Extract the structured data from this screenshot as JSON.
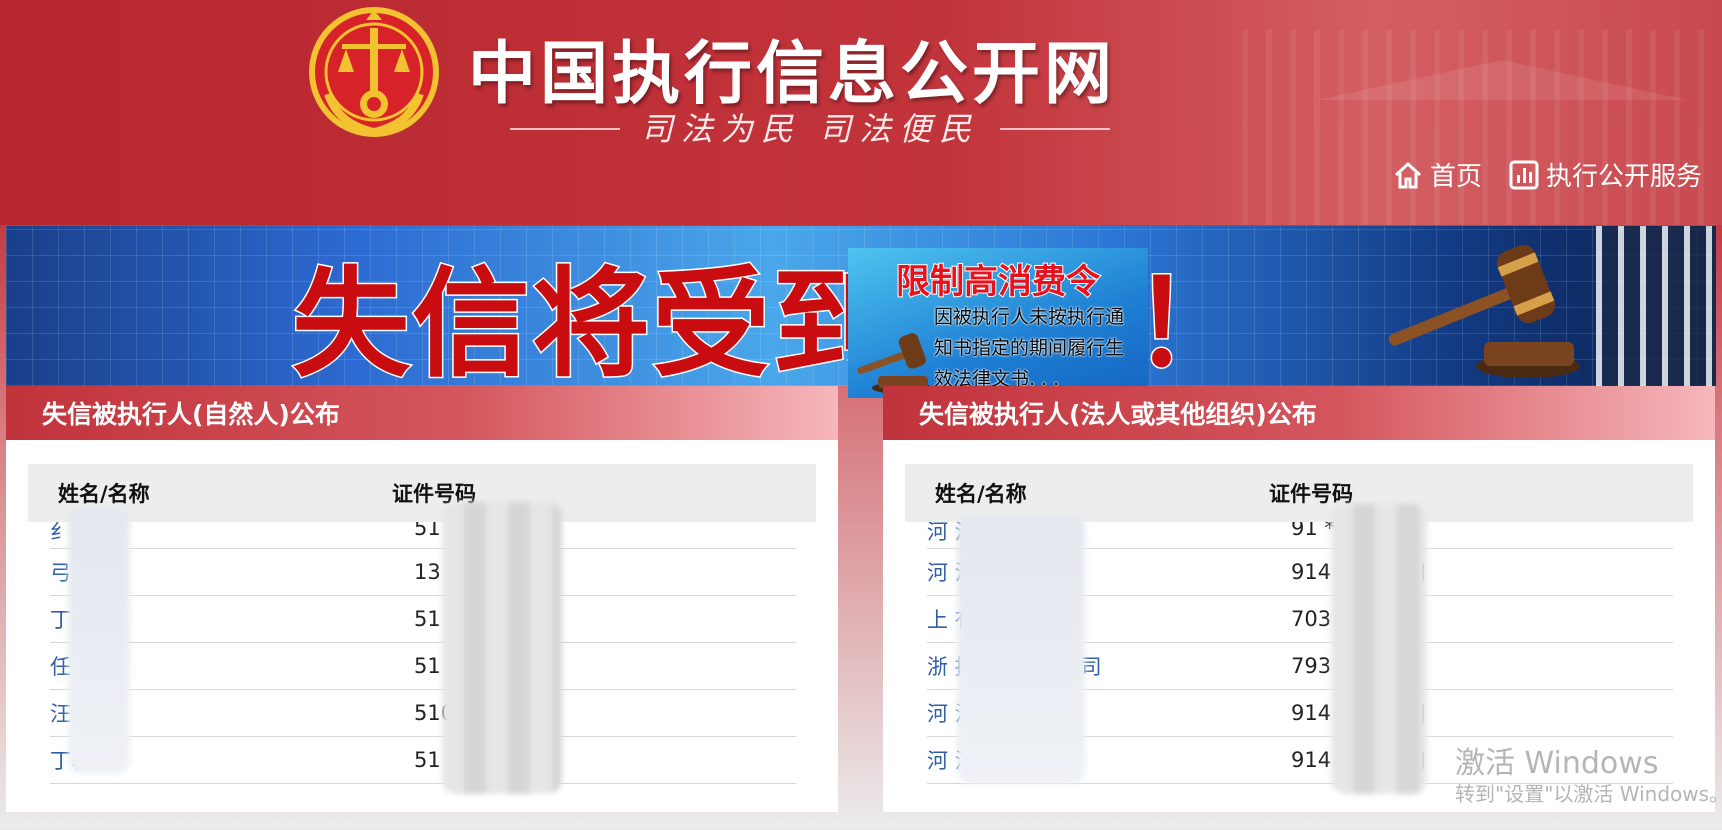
{
  "header": {
    "title": "中国执行信息公开网",
    "slogan": "司法为民   司法便民",
    "nav": [
      {
        "label": "首页",
        "icon": "home-icon"
      },
      {
        "label": "执行公开服务",
        "icon": "chart-icon"
      }
    ]
  },
  "banner": {
    "text": "失信将受到惩戒！"
  },
  "popup": {
    "title": "限制高消费令",
    "body": "因被执行人未按执行通知书指定的期间履行生效法律文书. . ."
  },
  "left_panel": {
    "title": "失信被执行人(自然人)公布",
    "columns": [
      "姓名/名称",
      "证件号码"
    ],
    "rows": [
      {
        "name": "纟",
        "id": "51        **2911"
      },
      {
        "name": "弓",
        "id": "13        ***005X"
      },
      {
        "name": "丁",
        "id": "51        ***6314"
      },
      {
        "name": "任",
        "id": "51        ***0846"
      },
      {
        "name": "汪",
        "id": "510       **0314"
      },
      {
        "name": "丁朝凤",
        "id": "51        ***6327"
      }
    ]
  },
  "right_panel": {
    "title": "失信被执行人(法人或其他组织)公布",
    "columns": [
      "姓名/名称",
      "证件号码"
    ],
    "rows": [
      {
        "name": "河             油站",
        "id": "91         ****977J"
      },
      {
        "name": "河             油站",
        "id": "914         ****977J"
      },
      {
        "name": "上             有限公司",
        "id": "703"
      },
      {
        "name": "浙             技有限责任公司",
        "id": "793"
      },
      {
        "name": "河             油站",
        "id": "914         ****977J"
      },
      {
        "name": "河             油站",
        "id": "914         ****977J"
      }
    ]
  },
  "watermark": {
    "line1": "激活 Windows",
    "line2": "转到\"设置\"以激活 Windows。"
  },
  "colors": {
    "brand_red": "#c0333a",
    "link_blue": "#2f5fa7",
    "header_gray": "#ededed"
  }
}
